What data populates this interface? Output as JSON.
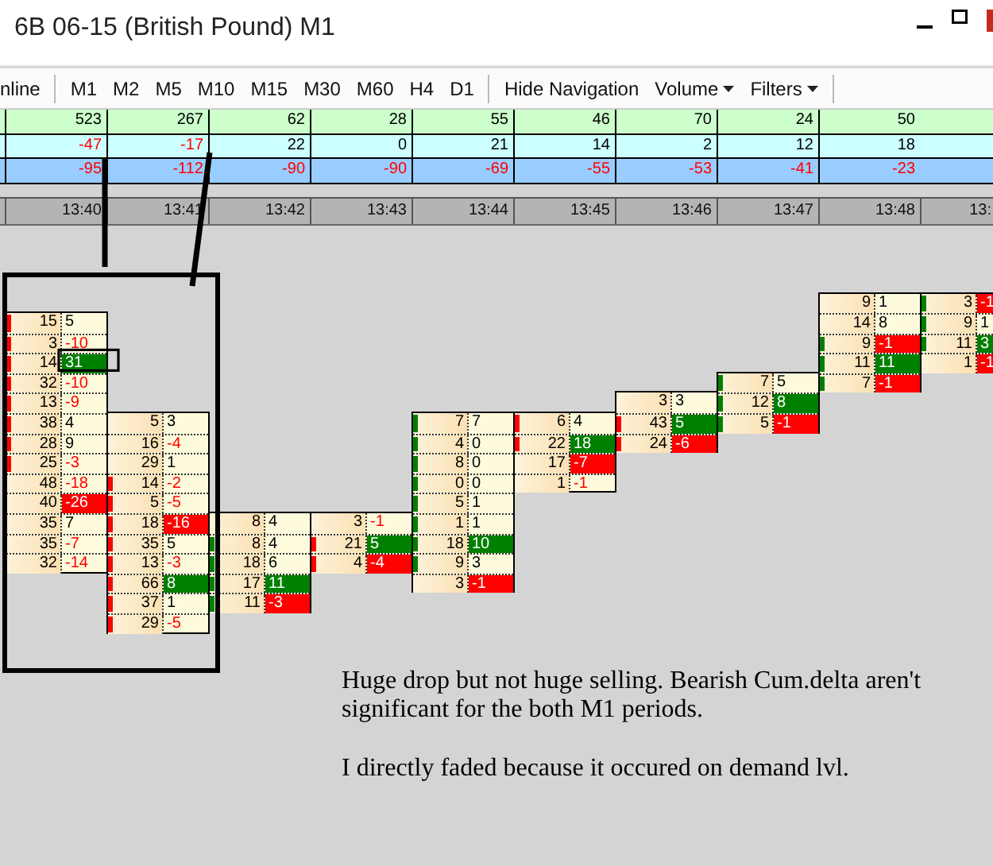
{
  "window": {
    "title": "6B 06-15 (British Pound) M1"
  },
  "toolbar": {
    "mode": "nline",
    "timeframes": [
      "M1",
      "M2",
      "M5",
      "M10",
      "M15",
      "M30",
      "M60",
      "H4",
      "D1"
    ],
    "actions": [
      {
        "label": "Hide Navigation",
        "dropdown": false
      },
      {
        "label": "Volume",
        "dropdown": true
      },
      {
        "label": "Filters",
        "dropdown": true
      }
    ]
  },
  "summary": {
    "volume": [
      "523",
      "267",
      "62",
      "28",
      "55",
      "46",
      "70",
      "24",
      "50"
    ],
    "delta": [
      "-47",
      "-17",
      "22",
      "0",
      "21",
      "14",
      "2",
      "12",
      "18"
    ],
    "cum_delta": [
      "-95",
      "-112",
      "-90",
      "-90",
      "-69",
      "-55",
      "-53",
      "-41",
      "-23"
    ],
    "times": [
      "13:40",
      "13:41",
      "13:42",
      "13:43",
      "13:44",
      "13:45",
      "13:46",
      "13:47",
      "13:48",
      "13:"
    ]
  },
  "candles": [
    {
      "rows": [
        {
          "bid": "15",
          "ask": "5",
          "kind": "plain",
          "color": "#ff0000"
        },
        {
          "bid": "3",
          "ask": "-10",
          "kind": "plain",
          "color": "#ff0000"
        },
        {
          "bid": "14",
          "ask": "31",
          "kind": "buy",
          "color": "#ff0000"
        },
        {
          "bid": "32",
          "ask": "-10",
          "kind": "plain",
          "color": "#ff0000"
        },
        {
          "bid": "13",
          "ask": "-9",
          "kind": "plain",
          "color": "#ff0000"
        },
        {
          "bid": "38",
          "ask": "4",
          "kind": "plain",
          "color": "#ff0000"
        },
        {
          "bid": "28",
          "ask": "9",
          "kind": "plain",
          "color": "#ff0000"
        },
        {
          "bid": "25",
          "ask": "-3",
          "kind": "plain",
          "color": "#ff0000"
        },
        {
          "bid": "48",
          "ask": "-18",
          "kind": "plain"
        },
        {
          "bid": "40",
          "ask": "-26",
          "kind": "sell"
        },
        {
          "bid": "35",
          "ask": "7",
          "kind": "plain"
        },
        {
          "bid": "35",
          "ask": "-7",
          "kind": "plain"
        },
        {
          "bid": "32",
          "ask": "-14",
          "kind": "plain"
        }
      ]
    },
    {
      "rows": [
        {
          "bid": "5",
          "ask": "3",
          "kind": "plain"
        },
        {
          "bid": "16",
          "ask": "-4",
          "kind": "plain"
        },
        {
          "bid": "29",
          "ask": "1",
          "kind": "plain"
        },
        {
          "bid": "14",
          "ask": "-2",
          "kind": "plain",
          "color": "#ff0000"
        },
        {
          "bid": "5",
          "ask": "-5",
          "kind": "plain",
          "color": "#ff0000"
        },
        {
          "bid": "18",
          "ask": "-16",
          "kind": "sell",
          "color": "#ff0000"
        },
        {
          "bid": "35",
          "ask": "5",
          "kind": "plain",
          "color": "#ff0000"
        },
        {
          "bid": "13",
          "ask": "-3",
          "kind": "plain",
          "color": "#ff0000"
        },
        {
          "bid": "66",
          "ask": "8",
          "kind": "buy",
          "color": "#ff0000"
        },
        {
          "bid": "37",
          "ask": "1",
          "kind": "plain",
          "color": "#ff0000"
        },
        {
          "bid": "29",
          "ask": "-5",
          "kind": "plain",
          "color": "#ff0000"
        }
      ]
    },
    {
      "rows": [
        {
          "bid": "8",
          "ask": "4",
          "kind": "plain"
        },
        {
          "bid": "8",
          "ask": "4",
          "kind": "plain",
          "color": "#008000"
        },
        {
          "bid": "18",
          "ask": "6",
          "kind": "plain",
          "color": "#008000"
        },
        {
          "bid": "17",
          "ask": "11",
          "kind": "buy",
          "color": "#008000"
        },
        {
          "bid": "11",
          "ask": "-3",
          "kind": "sell",
          "color": "#008000"
        }
      ]
    },
    {
      "rows": [
        {
          "bid": "3",
          "ask": "-1",
          "kind": "plain"
        },
        {
          "bid": "21",
          "ask": "5",
          "kind": "buy",
          "color": "#ff0000"
        },
        {
          "bid": "4",
          "ask": "-4",
          "kind": "sell",
          "color": "#ff0000"
        }
      ]
    },
    {
      "rows": [
        {
          "bid": "7",
          "ask": "7",
          "kind": "plain",
          "color": "#008000"
        },
        {
          "bid": "4",
          "ask": "0",
          "kind": "plain",
          "color": "#008000"
        },
        {
          "bid": "8",
          "ask": "0",
          "kind": "plain",
          "color": "#008000"
        },
        {
          "bid": "0",
          "ask": "0",
          "kind": "plain",
          "color": "#008000"
        },
        {
          "bid": "5",
          "ask": "1",
          "kind": "plain",
          "color": "#008000"
        },
        {
          "bid": "1",
          "ask": "1",
          "kind": "plain",
          "color": "#008000"
        },
        {
          "bid": "18",
          "ask": "10",
          "kind": "buy",
          "color": "#008000"
        },
        {
          "bid": "9",
          "ask": "3",
          "kind": "plain",
          "color": "#008000"
        },
        {
          "bid": "3",
          "ask": "-1",
          "kind": "sell"
        }
      ]
    },
    {
      "rows": [
        {
          "bid": "6",
          "ask": "4",
          "kind": "plain",
          "color": "#ff0000"
        },
        {
          "bid": "22",
          "ask": "18",
          "kind": "buy",
          "color": "#ff0000"
        },
        {
          "bid": "17",
          "ask": "-7",
          "kind": "sell"
        },
        {
          "bid": "1",
          "ask": "-1",
          "kind": "plain"
        }
      ]
    },
    {
      "rows": [
        {
          "bid": "3",
          "ask": "3",
          "kind": "plain"
        },
        {
          "bid": "43",
          "ask": "5",
          "kind": "buy",
          "color": "#ff0000"
        },
        {
          "bid": "24",
          "ask": "-6",
          "kind": "sell",
          "color": "#ff0000"
        }
      ]
    },
    {
      "rows": [
        {
          "bid": "7",
          "ask": "5",
          "kind": "plain",
          "color": "#008000"
        },
        {
          "bid": "12",
          "ask": "8",
          "kind": "buy",
          "color": "#008000"
        },
        {
          "bid": "5",
          "ask": "-1",
          "kind": "sell",
          "color": "#008000"
        }
      ]
    },
    {
      "rows": [
        {
          "bid": "9",
          "ask": "1",
          "kind": "plain"
        },
        {
          "bid": "14",
          "ask": "8",
          "kind": "plain"
        },
        {
          "bid": "9",
          "ask": "-1",
          "kind": "sell",
          "color": "#008000"
        },
        {
          "bid": "11",
          "ask": "11",
          "kind": "buy",
          "color": "#008000"
        },
        {
          "bid": "7",
          "ask": "-1",
          "kind": "sell",
          "color": "#008000"
        }
      ]
    },
    {
      "rows": [
        {
          "bid": "3",
          "ask": "-1",
          "kind": "sell",
          "color": "#008000"
        },
        {
          "bid": "9",
          "ask": "1",
          "kind": "plain",
          "color": "#008000"
        },
        {
          "bid": "11",
          "ask": "3",
          "kind": "buy",
          "color": "#008000"
        },
        {
          "bid": "1",
          "ask": "-1",
          "kind": "sell"
        }
      ]
    }
  ],
  "notes": [
    "Huge drop but not huge selling. Bearish Cum.delta aren't significant for the both M1 periods.",
    "I directly faded because it occured on demand lvl."
  ]
}
